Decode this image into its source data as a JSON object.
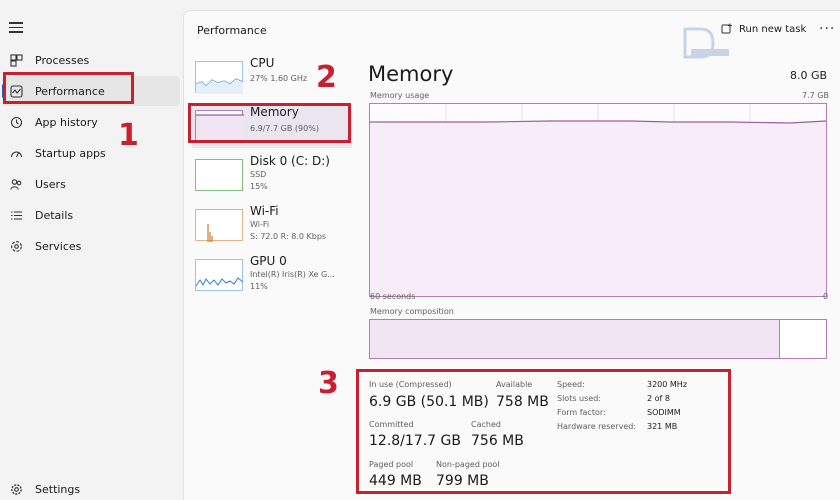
{
  "nav": {
    "items": [
      {
        "label": "Processes",
        "icon": "processes-icon"
      },
      {
        "label": "Performance",
        "icon": "performance-icon"
      },
      {
        "label": "App history",
        "icon": "app-history-icon"
      },
      {
        "label": "Startup apps",
        "icon": "startup-apps-icon"
      },
      {
        "label": "Users",
        "icon": "users-icon"
      },
      {
        "label": "Details",
        "icon": "details-icon"
      },
      {
        "label": "Services",
        "icon": "services-icon"
      }
    ],
    "settings_label": "Settings"
  },
  "header": {
    "title": "Performance",
    "run_task_label": "Run new task",
    "more_label": "···"
  },
  "devices": [
    {
      "name": "CPU",
      "sub1": "27%  1.60 GHz",
      "sub2": "",
      "sub3": ""
    },
    {
      "name": "Memory",
      "sub1": "6.9/7.7 GB (90%)",
      "sub2": "",
      "sub3": ""
    },
    {
      "name": "Disk 0 (C: D:)",
      "sub1": "SSD",
      "sub2": "15%",
      "sub3": ""
    },
    {
      "name": "Wi-Fi",
      "sub1": "Wi-Fi",
      "sub2": "S: 72.0  R: 8.0 Kbps",
      "sub3": ""
    },
    {
      "name": "GPU 0",
      "sub1": "Intel(R) Iris(R) Xe G...",
      "sub2": "11%",
      "sub3": ""
    }
  ],
  "memory": {
    "title": "Memory",
    "total": "8.0 GB",
    "usage_label": "Memory usage",
    "usage_max": "7.7 GB",
    "time_left": "60 seconds",
    "time_right": "0",
    "composition_label": "Memory composition",
    "composition_in_use_fraction": 0.9,
    "stats": {
      "in_use_label": "In use (Compressed)",
      "in_use_value": "6.9 GB (50.1 MB)",
      "available_label": "Available",
      "available_value": "758 MB",
      "committed_label": "Committed",
      "committed_value": "12.8/17.7 GB",
      "cached_label": "Cached",
      "cached_value": "756 MB",
      "paged_label": "Paged pool",
      "paged_value": "449 MB",
      "nonpaged_label": "Non-paged pool",
      "nonpaged_value": "799 MB"
    },
    "hw": [
      {
        "key": "Speed:",
        "value": "3200 MHz"
      },
      {
        "key": "Slots used:",
        "value": "2 of 8"
      },
      {
        "key": "Form factor:",
        "value": "SODIMM"
      },
      {
        "key": "Hardware reserved:",
        "value": "321 MB"
      }
    ]
  },
  "annotations": [
    "1",
    "2",
    "3"
  ],
  "colors": {
    "annotation_red": "#c8202f",
    "memory_purple": "#b07fb3",
    "memory_fill": "#f1e4f3",
    "cpu_blue": "#2f7fc7",
    "wifi_orange": "#c77a2f"
  }
}
